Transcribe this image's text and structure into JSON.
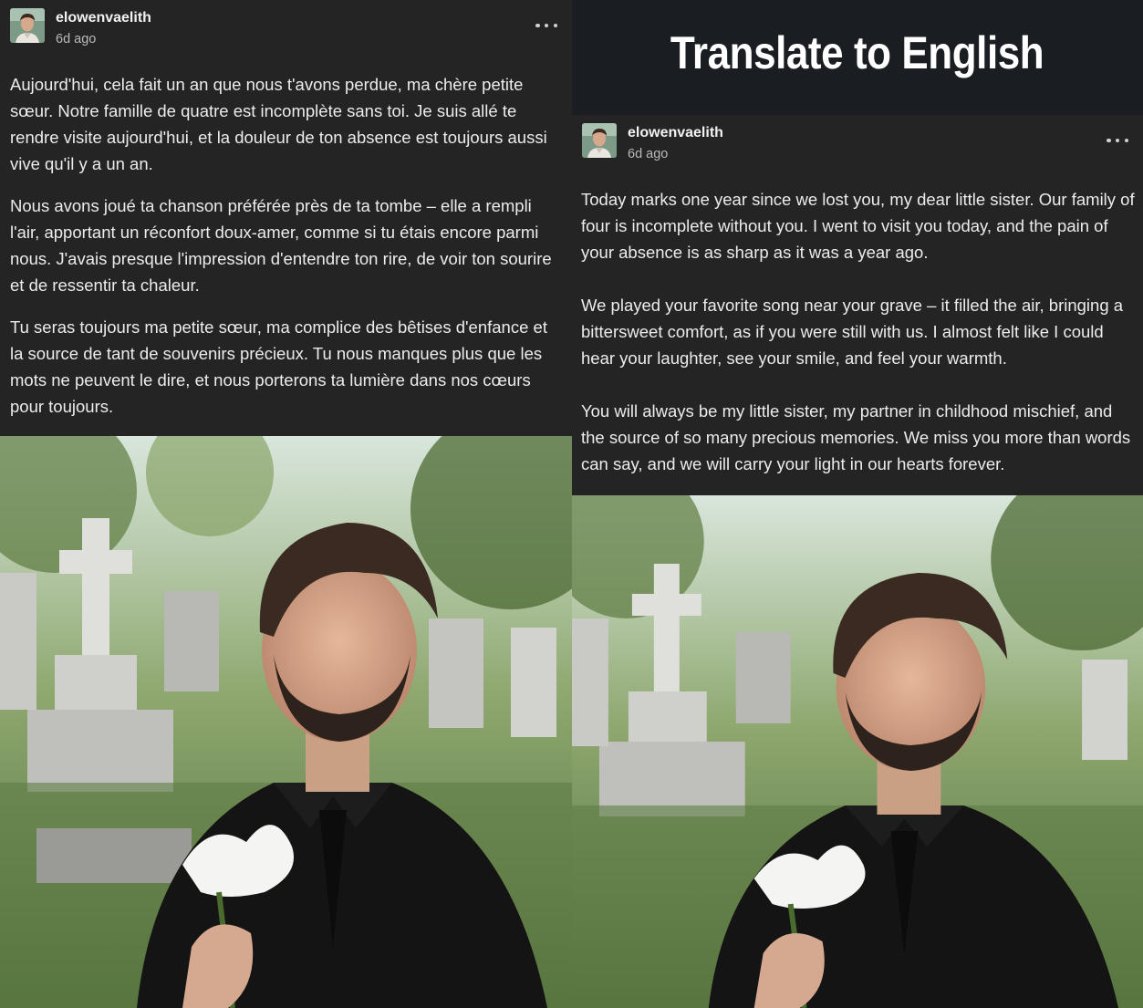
{
  "banner": {
    "title": "Translate to English"
  },
  "original_post": {
    "username": "elowenvaelith",
    "timestamp": "6d ago",
    "paragraphs": [
      "Aujourd'hui, cela fait un an que nous t'avons perdue, ma chère petite sœur. Notre famille de quatre est incomplète sans toi. Je suis allé te rendre visite aujourd'hui, et la douleur de ton absence est toujours aussi vive qu'il y a un an.",
      "Nous avons joué ta chanson préférée près de ta tombe – elle a rempli l'air, apportant un réconfort doux-amer, comme si tu étais encore parmi nous. J'avais presque l'impression d'entendre ton rire, de voir ton sourire et de ressentir ta chaleur.",
      "Tu seras toujours ma petite sœur, ma complice des bêtises d'enfance et la source de tant de souvenirs précieux. Tu nous manques plus que les mots ne peuvent le dire, et nous porterons ta lumière dans nos cœurs pour toujours."
    ],
    "image_icon": "cemetery-photo"
  },
  "translated_post": {
    "username": "elowenvaelith",
    "timestamp": "6d ago",
    "paragraphs": [
      "Today marks one year since we lost you, my dear little sister. Our family of four is incomplete without you. I went to visit you today, and the pain of your absence is as sharp as it was a year ago.",
      "We played your favorite song near your grave – it filled the air, bringing a bittersweet comfort, as if you were still with us. I almost felt like I could hear your laughter, see your smile, and feel your warmth.",
      "You will always be my little sister, my partner in childhood mischief, and the source of so many precious memories. We miss you more than words can say, and we will carry your light in our hearts forever."
    ],
    "image_icon": "cemetery-photo"
  },
  "colors": {
    "background": "#1a1d22",
    "panel": "#242424",
    "text": "#ececec",
    "muted": "#b9b9b9"
  }
}
